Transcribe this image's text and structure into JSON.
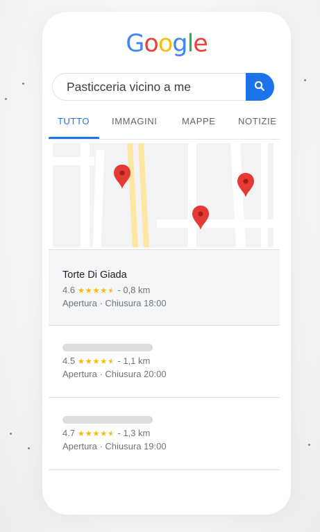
{
  "logo": {
    "letters": [
      {
        "ch": "G",
        "color": "#4285f4"
      },
      {
        "ch": "o",
        "color": "#ea4335"
      },
      {
        "ch": "o",
        "color": "#fbbc05"
      },
      {
        "ch": "g",
        "color": "#4285f4"
      },
      {
        "ch": "l",
        "color": "#34a853"
      },
      {
        "ch": "e",
        "color": "#ea4335"
      }
    ]
  },
  "search": {
    "query": "Pasticceria vicino a me",
    "button_icon": "search-icon",
    "button_color": "#1a73e8"
  },
  "tabs": [
    {
      "label": "TUTTO",
      "active": true
    },
    {
      "label": "IMMAGINI",
      "active": false
    },
    {
      "label": "MAPPE",
      "active": false
    },
    {
      "label": "NOTIZIE",
      "active": false
    }
  ],
  "map": {
    "pin_icon": "map-pin-icon",
    "pin_color": "#e53935",
    "road_color": "#ffffff",
    "highway_color": "#fbe7a1"
  },
  "results": [
    {
      "name": "Torte Di Giada",
      "rating": "4.6",
      "stars": "★★★★",
      "half_star": "★",
      "distance": "- 0,8 km",
      "hours": "Apertura · Chiusura 18:00",
      "highlighted": true
    },
    {
      "name": "",
      "rating": "4.5",
      "stars": "★★★★",
      "half_star": "★",
      "distance": "- 1,1 km",
      "hours": "Apertura · Chiusura 20:00",
      "highlighted": false
    },
    {
      "name": "",
      "rating": "4.7",
      "stars": "★★★★",
      "half_star": "★",
      "distance": "- 1,3 km",
      "hours": "Apertura · Chiusura 19:00",
      "highlighted": false
    }
  ],
  "colors": {
    "accent": "#1a73e8",
    "star": "#fbbc04",
    "highlight_bg": "#f5f6f8"
  }
}
